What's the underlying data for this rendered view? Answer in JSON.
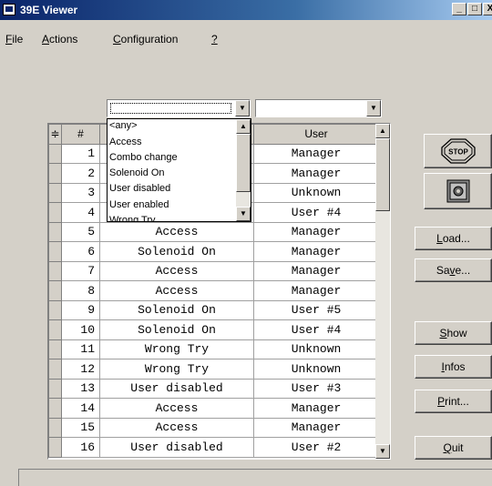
{
  "window": {
    "title": "39E Viewer",
    "minimize": "_",
    "maximize": "□",
    "close": "X"
  },
  "menu": [
    "File",
    "Actions",
    "Configuration",
    "?"
  ],
  "filters": {
    "event_value": "",
    "user_value": ""
  },
  "dropdown": {
    "options": [
      "<any>",
      "Access",
      "Combo change",
      "Solenoid On",
      "User disabled",
      "User enabled",
      "Wrong Try"
    ]
  },
  "grid": {
    "headers": {
      "sort_icon": "≑",
      "number": "#",
      "event": "",
      "user": "User"
    },
    "rows": [
      {
        "n": "1",
        "event": "",
        "user": "Manager"
      },
      {
        "n": "2",
        "event": "",
        "user": "Manager"
      },
      {
        "n": "3",
        "event": "",
        "user": "Unknown"
      },
      {
        "n": "4",
        "event": "",
        "user": "User #4"
      },
      {
        "n": "5",
        "event": "Access",
        "user": "Manager"
      },
      {
        "n": "6",
        "event": "Solenoid On",
        "user": "Manager"
      },
      {
        "n": "7",
        "event": "Access",
        "user": "Manager"
      },
      {
        "n": "8",
        "event": "Access",
        "user": "Manager"
      },
      {
        "n": "9",
        "event": "Solenoid On",
        "user": "User #5"
      },
      {
        "n": "10",
        "event": "Solenoid On",
        "user": "User #4"
      },
      {
        "n": "11",
        "event": "Wrong Try",
        "user": "Unknown"
      },
      {
        "n": "12",
        "event": "Wrong Try",
        "user": "Unknown"
      },
      {
        "n": "13",
        "event": "User disabled",
        "user": "User #3"
      },
      {
        "n": "14",
        "event": "Access",
        "user": "Manager"
      },
      {
        "n": "15",
        "event": "Access",
        "user": "Manager"
      },
      {
        "n": "16",
        "event": "User disabled",
        "user": "User #2"
      }
    ]
  },
  "buttons": {
    "stop": "STOP",
    "load": "Load...",
    "save": "Save...",
    "show": "Show",
    "infos": "Infos",
    "print": "Print...",
    "quit": "Quit"
  },
  "icons": {
    "safe": "safe-icon",
    "stop": "stop-sign-icon",
    "app": "app-window-icon"
  }
}
